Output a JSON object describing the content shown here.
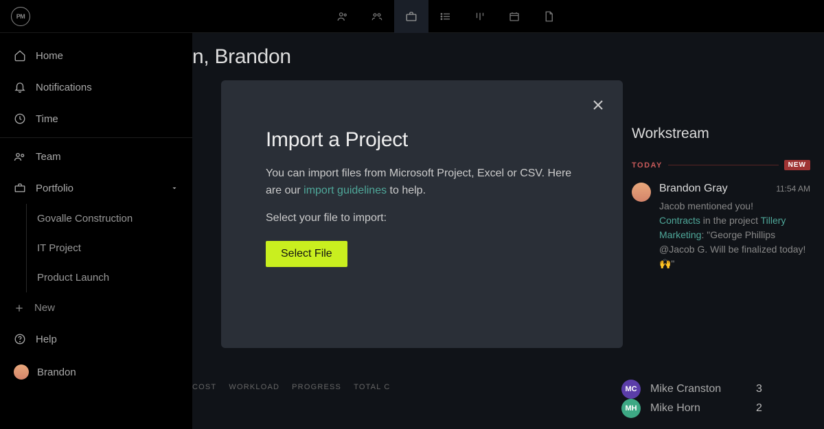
{
  "logo": "PM",
  "page_title_partial": "n, Brandon",
  "sidebar": {
    "home": "Home",
    "notifications": "Notifications",
    "time": "Time",
    "team": "Team",
    "portfolio": "Portfolio",
    "subs": [
      "Govalle Construction",
      "IT Project",
      "Product Launch"
    ],
    "new": "New",
    "help": "Help",
    "user": "Brandon"
  },
  "columns": {
    "cost": "COST",
    "workload": "WORKLOAD",
    "progress": "PROGRESS",
    "total": "TOTAL C"
  },
  "team_list": [
    {
      "initials": "MC",
      "color": "#5b3da8",
      "name": "Mike Cranston",
      "count": "3"
    },
    {
      "initials": "MH",
      "color": "#3da884",
      "name": "Mike Horn",
      "count": "2"
    }
  ],
  "workstream": {
    "title": "Workstream",
    "today": "TODAY",
    "new_badge": "NEW",
    "item": {
      "name": "Brandon Gray",
      "time": "11:54 AM",
      "line1": "Jacob mentioned you!",
      "link1": "Contracts",
      "mid": " in the project ",
      "link2": "Tillery Marketing",
      "after": ": \"George Phillips @Jacob G. Will be finalized today! 🙌\""
    }
  },
  "modal": {
    "title": "Import a Project",
    "body_pre": "You can import files from Microsoft Project, Excel or CSV. Here are our ",
    "body_link": "import guidelines",
    "body_post": " to help.",
    "select_prompt": "Select your file to import:",
    "button": "Select File"
  }
}
